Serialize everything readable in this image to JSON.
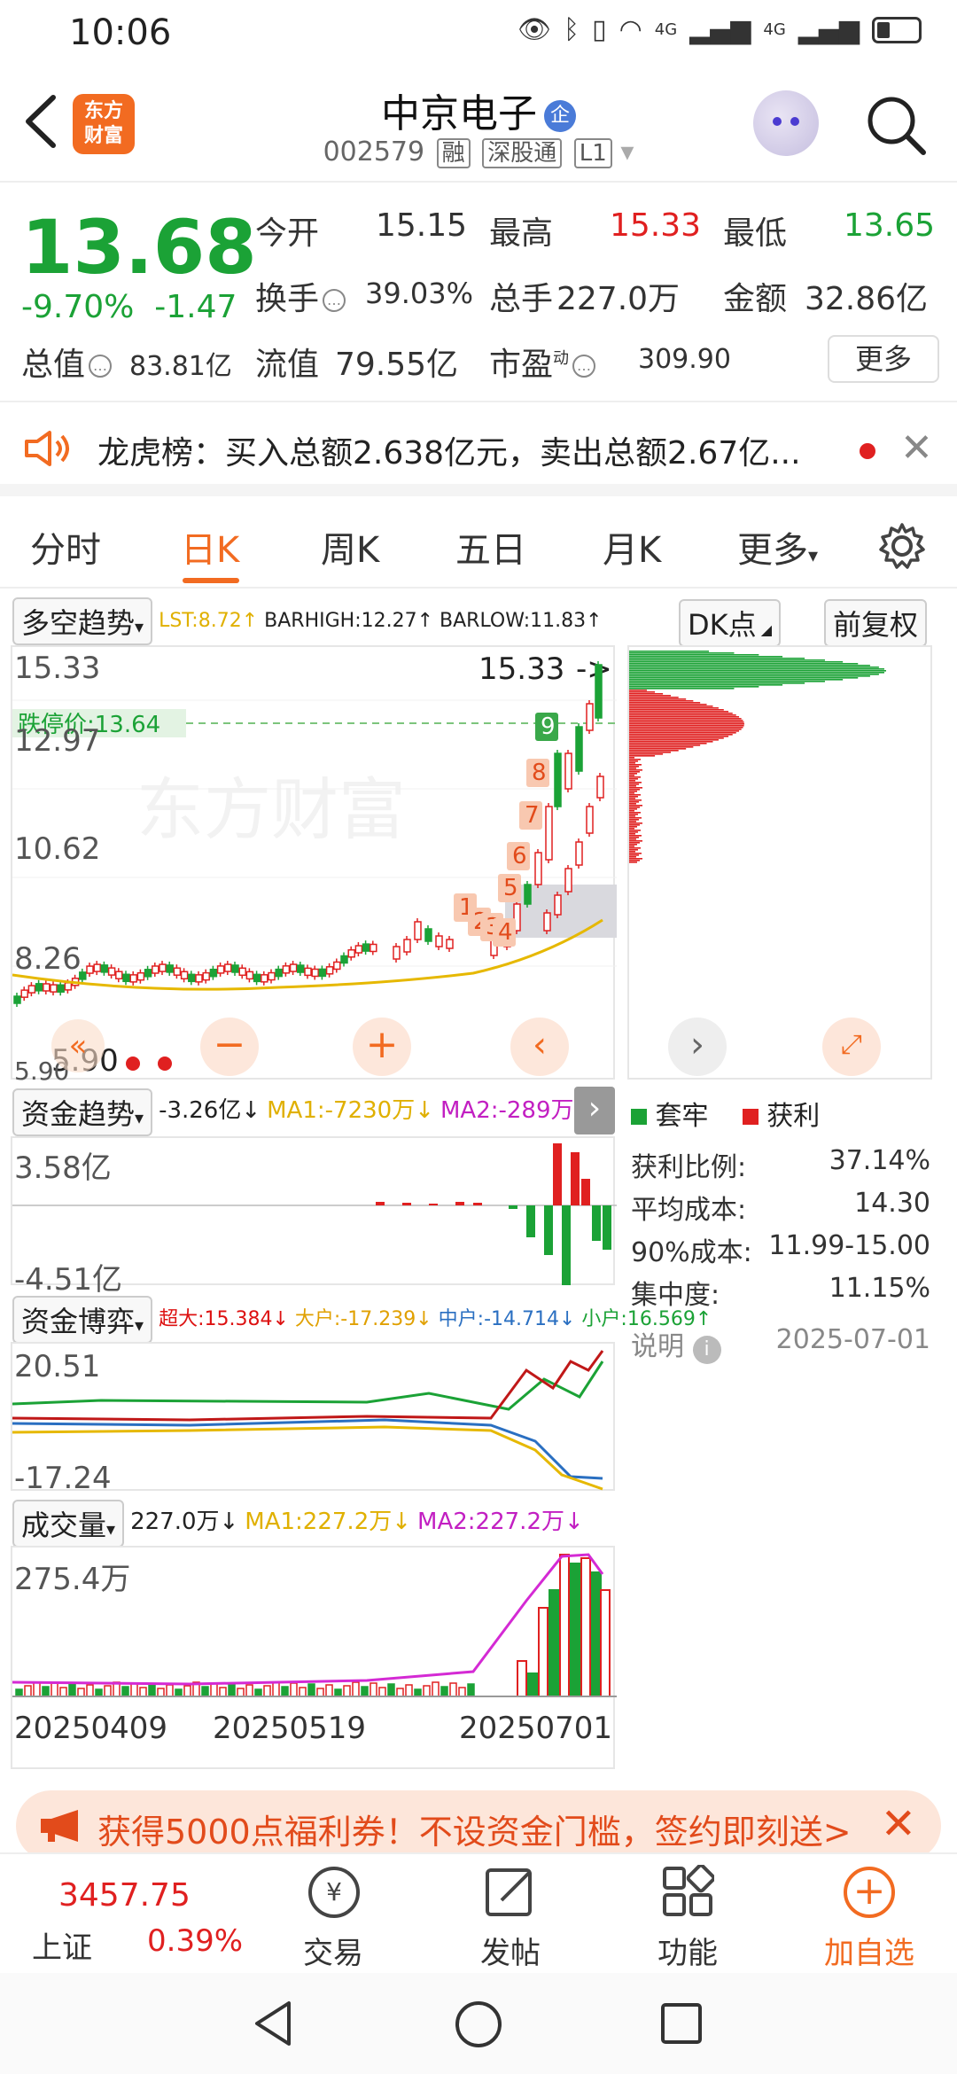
{
  "status": {
    "time": "10:06",
    "signal_a": "4G",
    "signal_b": "4G"
  },
  "header": {
    "logo_line1": "东方",
    "logo_line2": "财富",
    "stock_name": "中京电子",
    "name_badge": "企",
    "code": "002579",
    "tag1": "融",
    "tag2": "深股通",
    "tag3": "L1"
  },
  "quote": {
    "price": "13.68",
    "change_pct": "-9.70%",
    "change_amt": "-1.47",
    "open_label": "今开",
    "open": "15.15",
    "high_label": "最高",
    "high": "15.33",
    "low_label": "最低",
    "low": "13.65",
    "turnover_label": "换手",
    "turnover": "39.03%",
    "volume_label": "总手",
    "volume": "227.0万",
    "amount_label": "金额",
    "amount": "32.86亿",
    "mcap_label": "总值",
    "mcap": "83.81亿",
    "float_label": "流值",
    "float": "79.55亿",
    "pe_label": "市盈",
    "pe_sup": "动",
    "pe": "309.90",
    "more": "更多"
  },
  "news": {
    "text": "龙虎榜：买入总额2.638亿元，卖出总额2.67亿..."
  },
  "tabs": [
    "分时",
    "日K",
    "周K",
    "五日",
    "月K",
    "更多"
  ],
  "kline": {
    "indicator": "多空趋势",
    "lst": "LST:8.72↑",
    "barhigh": "BARHIGH:12.27↑",
    "barlow": "BARLOW:11.83↑",
    "dk_btn": "DK点",
    "adj_btn": "前复权",
    "y_top": "15.33",
    "y_2": "12.97",
    "y_3": "10.62",
    "y_4": "8.26",
    "y_bot": "5.90",
    "limit_label": "跌停价:13.64",
    "high_mark": "15.33",
    "low_mark": "5.90",
    "signal_nums": [
      "1",
      "2",
      "3",
      "4",
      "5",
      "6",
      "7",
      "8",
      "9"
    ],
    "watermark": "东方财富"
  },
  "fund_trend": {
    "name": "资金趋势",
    "val": "-3.26亿↓",
    "ma1": "MA1:-7230万↓",
    "ma2": "MA2:-289万↓",
    "y_top": "3.58亿",
    "y_bot": "-4.51亿"
  },
  "fund_game": {
    "name": "资金博弈",
    "super": "超大:15.384↓",
    "big": "大户:-17.239↓",
    "mid": "中户:-14.714↓",
    "small": "小户:16.569↑",
    "y_top": "20.51",
    "y_bot": "-17.24"
  },
  "volume": {
    "name": "成交量",
    "val": "227.0万↓",
    "ma1": "MA1:227.2万↓",
    "ma2": "MA2:227.2万↓",
    "y_top": "275.4万",
    "dates": [
      "20250409",
      "20250519",
      "20250701"
    ]
  },
  "chips": {
    "legend_solid": "套牢",
    "legend_profit": "获利",
    "profit_ratio_label": "获利比例:",
    "profit_ratio": "37.14%",
    "avg_cost_label": "平均成本:",
    "avg_cost": "14.30",
    "cost90_label": "90%成本:",
    "cost90": "11.99-15.00",
    "concentration_label": "集中度:",
    "concentration": "11.15%",
    "note_label": "说明",
    "date": "2025-07-01"
  },
  "promo": {
    "text": "获得5000点福利券！不设资金门槛，签约即刻送>"
  },
  "bottom": {
    "index_value": "3457.75",
    "index_name": "上证",
    "index_pct": "0.39%",
    "trade": "交易",
    "post": "发帖",
    "func": "功能",
    "add": "加自选"
  },
  "colors": {
    "up": "#e02020",
    "down": "#1ba236",
    "accent": "#f26b21"
  }
}
